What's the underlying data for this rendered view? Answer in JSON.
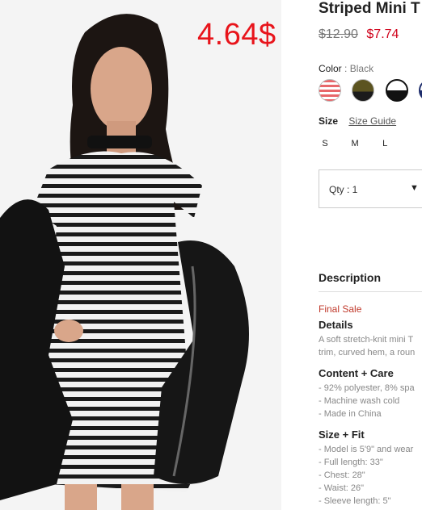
{
  "image": {
    "price_overlay": "4.64$"
  },
  "product": {
    "title": "Striped Mini T",
    "old_price": "$12.90",
    "new_price": "$7.74"
  },
  "color": {
    "label": "Color",
    "separator": ":",
    "value": "Black",
    "swatches": [
      {
        "name": "red-stripe",
        "color": "#e8676a"
      },
      {
        "name": "olive",
        "color": "#5c5420"
      },
      {
        "name": "black",
        "color": "#111111"
      },
      {
        "name": "navy",
        "color": "#1d2c6b"
      }
    ]
  },
  "size": {
    "label": "Size",
    "guide_label": "Size Guide",
    "options": [
      "S",
      "M",
      "L"
    ]
  },
  "quantity": {
    "label": "Qty : 1",
    "caret": "▼"
  },
  "description": {
    "heading": "Description",
    "final_sale": "Final Sale",
    "details_title": "Details",
    "details_lines": [
      "A soft stretch-knit mini T",
      "trim, curved hem, a roun"
    ],
    "care_title": "Content + Care",
    "care_lines": [
      "- 92% polyester, 8% spa",
      "- Machine wash cold",
      "- Made in China"
    ],
    "fit_title": "Size + Fit",
    "fit_lines": [
      "- Model is 5'9\" and wear",
      "- Full length: 33\"",
      "- Chest: 28\"",
      "- Waist: 26\"",
      "- Sleeve length: 5\""
    ]
  },
  "colors": {
    "sale_red": "#d0021b",
    "overlay_red": "#e8141b"
  }
}
